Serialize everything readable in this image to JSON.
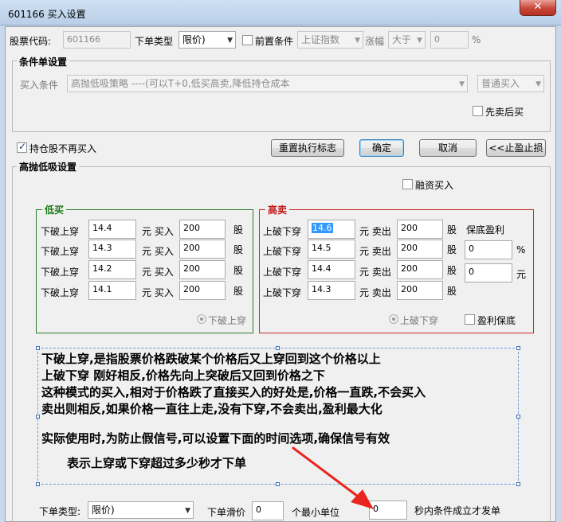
{
  "window": {
    "title": "601166 买入设置",
    "close_glyph": "✕"
  },
  "top_row": {
    "stock_code_label": "股票代码:",
    "stock_code_value": "601166",
    "order_type_label": "下单类型",
    "order_type_value": "限价)",
    "precondition_label": "前置条件",
    "index_value": "上证指数",
    "change_label": "涨幅",
    "compare_value": "大于",
    "change_value": "0",
    "percent_unit": "%"
  },
  "condition_group": {
    "legend": "条件单设置",
    "buy_condition_label": "买入条件",
    "strategy_value": "高抛低吸策略 ----(可以T+0,低买高卖,降低持仓成本",
    "buy_mode_value": "普通买入",
    "sell_first_label": "先卖后买"
  },
  "actions": {
    "no_buy_if_holding_label": "持仓股不再买入",
    "reset_flag_button": "重置执行标志",
    "ok_button": "确定",
    "cancel_button": "取消",
    "stop_button": "<<止盈止损"
  },
  "hilo_group": {
    "legend": "高抛低吸设置",
    "margin_buy_label": "融资买入",
    "low_buy": {
      "legend": "低买",
      "rows": [
        {
          "label": "下破上穿",
          "price": "14.4",
          "mid": "元 买入",
          "qty": "200",
          "unit": "股"
        },
        {
          "label": "下破上穿",
          "price": "14.3",
          "mid": "元 买入",
          "qty": "200",
          "unit": "股"
        },
        {
          "label": "下破上穿",
          "price": "14.2",
          "mid": "元 买入",
          "qty": "200",
          "unit": "股"
        },
        {
          "label": "下破上穿",
          "price": "14.1",
          "mid": "元 买入",
          "qty": "200",
          "unit": "股"
        }
      ],
      "radio_label": "下破上穿"
    },
    "high_sell": {
      "legend": "高卖",
      "rows": [
        {
          "label": "上破下穿",
          "price": "14.6",
          "mid": "元 卖出",
          "qty": "200",
          "unit": "股"
        },
        {
          "label": "上破下穿",
          "price": "14.5",
          "mid": "元 卖出",
          "qty": "200",
          "unit": "股"
        },
        {
          "label": "上破下穿",
          "price": "14.4",
          "mid": "元 卖出",
          "qty": "200",
          "unit": "股"
        },
        {
          "label": "上破下穿",
          "price": "14.3",
          "mid": "元 卖出",
          "qty": "200",
          "unit": "股"
        }
      ],
      "profit_protect_label": "保底盈利",
      "profit_pct_value": "0",
      "profit_pct_unit": "%",
      "profit_amt_value": "0",
      "profit_amt_unit": "元",
      "radio_label": "上破下穿",
      "profit_keep_label": "盈利保底"
    }
  },
  "notes": [
    "下破上穿,是指股票价格跌破某个价格后又上穿回到这个价格以上",
    "上破下穿 刚好相反,价格先向上突破后又回到价格之下",
    "这种模式的买入,相对于价格跌了直接买入的好处是,价格一直跌,不会买入",
    "卖出则相反,如果价格一直往上走,没有下穿,不会卖出,盈利最大化",
    "实际使用时,为防止假信号,可以设置下面的时间选项,确保信号有效",
    "表示上穿或下穿超过多少秒才下单"
  ],
  "bottom_row": {
    "order_type_label": "下单类型:",
    "order_type_value": "限价)",
    "slippage_label": "下单滑价",
    "slippage_value": "0",
    "min_unit_label": "个最小单位",
    "seconds_value": "0",
    "seconds_label": "秒内条件成立才发单"
  },
  "colors": {
    "low_buy": "#1a7a1a",
    "high_sell": "#c01818",
    "arrow": "#e8261f"
  }
}
